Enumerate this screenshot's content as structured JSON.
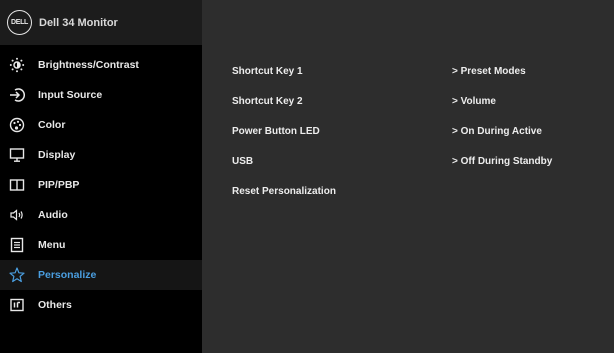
{
  "osd": {
    "logo_text": "DELL",
    "title": "Dell 34 Monitor",
    "accent_color": "#4a9ee0",
    "menu": [
      {
        "label": "Brightness/Contrast",
        "icon": "brightness-icon"
      },
      {
        "label": "Input Source",
        "icon": "input-source-icon"
      },
      {
        "label": "Color",
        "icon": "color-icon"
      },
      {
        "label": "Display",
        "icon": "display-icon"
      },
      {
        "label": "PIP/PBP",
        "icon": "pip-pbp-icon"
      },
      {
        "label": "Audio",
        "icon": "audio-icon"
      },
      {
        "label": "Menu",
        "icon": "menu-icon"
      },
      {
        "label": "Personalize",
        "icon": "star-icon",
        "selected": true
      },
      {
        "label": "Others",
        "icon": "others-icon"
      }
    ],
    "settings": [
      {
        "label": "Shortcut Key 1",
        "value": "> Preset Modes"
      },
      {
        "label": "Shortcut Key 2",
        "value": "> Volume"
      },
      {
        "label": "Power Button LED",
        "value": "> On During Active"
      },
      {
        "label": "USB",
        "value": "> Off During Standby"
      },
      {
        "label": "Reset Personalization",
        "value": ""
      }
    ]
  }
}
